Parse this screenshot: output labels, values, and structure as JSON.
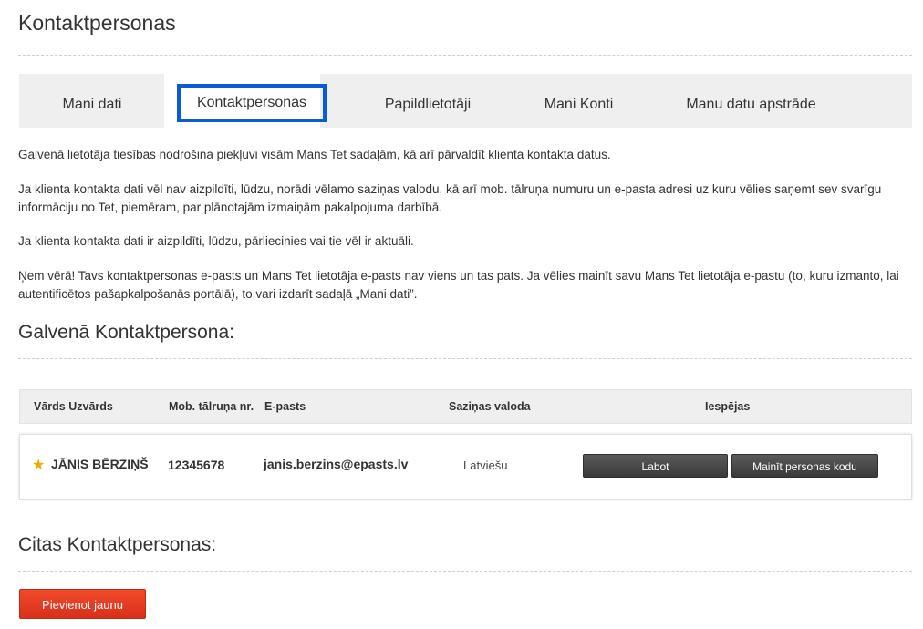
{
  "page": {
    "title": "Kontaktpersonas"
  },
  "tabs": [
    {
      "label": "Mani dati"
    },
    {
      "label": "Kontaktpersonas"
    },
    {
      "label": "Papildlietotāji"
    },
    {
      "label": "Mani Konti"
    },
    {
      "label": "Manu datu apstrāde"
    }
  ],
  "intro": {
    "p1": "Galvenā lietotāja tiesības nodrošina piekļuvi visām Mans Tet sadaļām, kā arī pārvaldīt klienta kontakta datus.",
    "p2": "Ja klienta kontakta dati vēl nav aizpildīti, lūdzu, norādi vēlamo saziņas valodu, kā arī mob. tālruņa numuru un e-pasta adresi uz kuru vēlies saņemt sev svarīgu informāciju no Tet, piemēram, par plānotajām izmaiņām pakalpojuma darbībā.",
    "p3": "Ja klienta kontakta dati ir aizpildīti, lūdzu, pārliecinies vai tie vēl ir aktuāli.",
    "p4": "Ņem vērā! Tavs kontaktpersonas e-pasts un Mans Tet lietotāja e-pasts nav viens un tas pats. Ja vēlies mainīt savu Mans Tet lietotāja e-pastu (to, kuru izmanto, lai autentificētos pašapkalpošanās portālā), to vari izdarīt sadaļā „Mani dati”."
  },
  "main_contact": {
    "title": "Galvenā Kontaktpersona:",
    "headers": {
      "name": "Vārds Uzvārds",
      "phone": "Mob. tālruņa nr.",
      "email": "E-pasts",
      "language": "Saziņas valoda",
      "options": "Iespējas"
    },
    "row": {
      "name": "JĀNIS BĒRZIŅŠ",
      "phone": "12345678",
      "email": "janis.berzins@epasts.lv",
      "language": "Latviešu",
      "edit_label": "Labot",
      "change_code_label": "Mainīt personas kodu"
    }
  },
  "other_contacts": {
    "title": "Citas Kontaktpersonas:",
    "add_label": "Pievienot jaunu"
  },
  "colors": {
    "accent_red": "#e33b1f",
    "focus_blue": "#0b5bd6",
    "star": "#f0a800"
  }
}
